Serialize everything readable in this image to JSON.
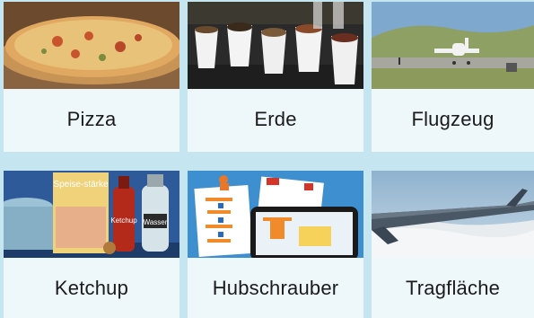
{
  "cards": [
    {
      "label": "Pizza",
      "image_icon": "pizza-photo"
    },
    {
      "label": "Erde",
      "image_icon": "soil-cups-photo"
    },
    {
      "label": "Flugzeug",
      "image_icon": "airplane-photo"
    },
    {
      "label": "Ketchup",
      "image_icon": "ketchup-bottles-photo"
    },
    {
      "label": "Hubschrauber",
      "image_icon": "helicopter-worksheet-photo"
    },
    {
      "label": "Tragfläche",
      "image_icon": "airplane-wing-photo"
    }
  ],
  "overlays": {
    "ketchup_bottle_text": "Ketchup",
    "water_bottle_text": "Wasser",
    "starch_box_text": "Speise-stärke"
  },
  "colors": {
    "background": "#c5e6f0",
    "card": "#eef8fb",
    "text": "#1b1b1b"
  }
}
